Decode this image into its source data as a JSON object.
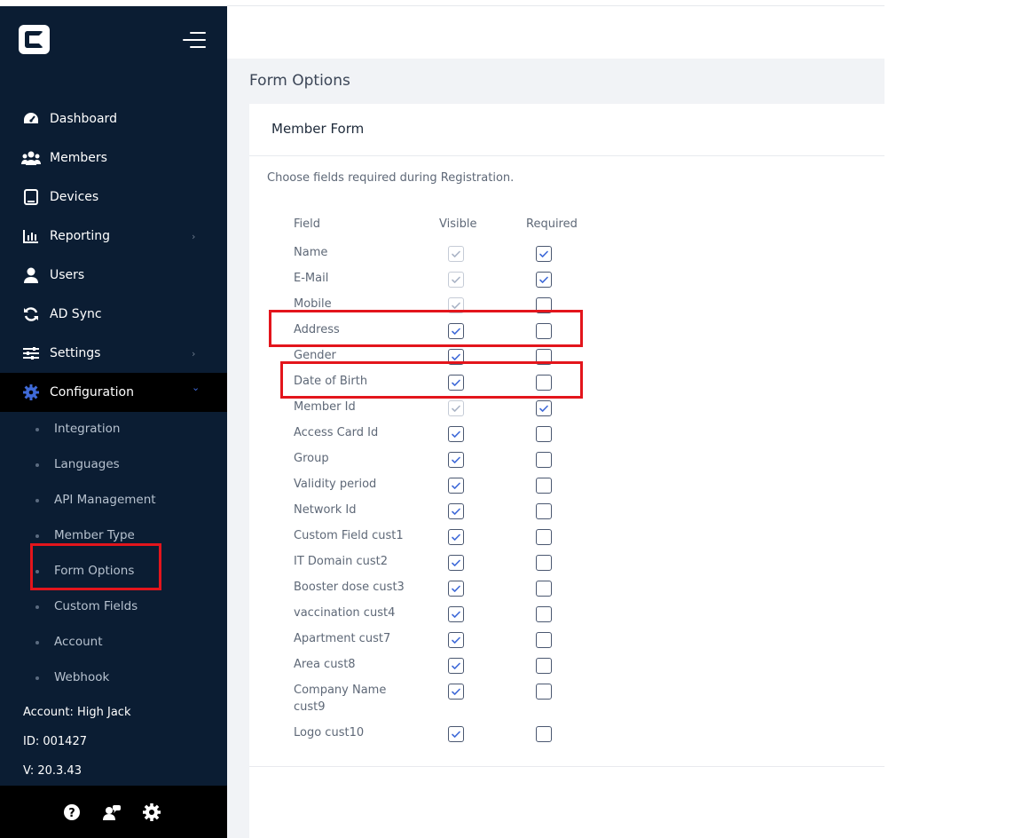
{
  "sidebar": {
    "nav": [
      {
        "label": "Dashboard",
        "icon": "dashboard-icon"
      },
      {
        "label": "Members",
        "icon": "members-icon"
      },
      {
        "label": "Devices",
        "icon": "tablet-icon"
      },
      {
        "label": "Reporting",
        "icon": "bar-chart-icon"
      },
      {
        "label": "Users",
        "icon": "user-icon"
      },
      {
        "label": "AD Sync",
        "icon": "sync-icon"
      },
      {
        "label": "Settings",
        "icon": "sliders-icon"
      },
      {
        "label": "Configuration",
        "icon": "gear-icon"
      }
    ],
    "chevron_right": "›",
    "chevron_down": "⌄",
    "sub": [
      {
        "label": "Integration"
      },
      {
        "label": "Languages"
      },
      {
        "label": "API Management"
      },
      {
        "label": "Member Type"
      },
      {
        "label": "Form Options"
      },
      {
        "label": "Custom Fields"
      },
      {
        "label": "Account"
      },
      {
        "label": "Webhook"
      }
    ],
    "account": "Account: High Jack",
    "id": "ID: 001427",
    "version": "V: 20.3.43",
    "footer_icons": [
      "help-icon",
      "user-chat-icon",
      "settings-gear-icon"
    ]
  },
  "page": {
    "title": "Form Options",
    "card_title": "Member Form",
    "description": "Choose fields required during Registration.",
    "columns": {
      "field": "Field",
      "visible": "Visible",
      "required": "Required"
    },
    "rows": [
      {
        "label": "Name",
        "visible": true,
        "visible_disabled": true,
        "required": true
      },
      {
        "label": "E-Mail",
        "visible": true,
        "visible_disabled": true,
        "required": true
      },
      {
        "label": "Mobile",
        "visible": true,
        "visible_disabled": true,
        "required": false
      },
      {
        "label": "Address",
        "visible": true,
        "visible_disabled": false,
        "required": false
      },
      {
        "label": "Gender",
        "visible": true,
        "visible_disabled": false,
        "required": false
      },
      {
        "label": "Date of Birth",
        "visible": true,
        "visible_disabled": false,
        "required": false
      },
      {
        "label": "Member Id",
        "visible": true,
        "visible_disabled": true,
        "required": true
      },
      {
        "label": "Access Card Id",
        "visible": true,
        "visible_disabled": false,
        "required": false
      },
      {
        "label": "Group",
        "visible": true,
        "visible_disabled": false,
        "required": false
      },
      {
        "label": "Validity period",
        "visible": true,
        "visible_disabled": false,
        "required": false
      },
      {
        "label": "Network Id",
        "visible": true,
        "visible_disabled": false,
        "required": false
      },
      {
        "label": "Custom Field cust1",
        "visible": true,
        "visible_disabled": false,
        "required": false
      },
      {
        "label": "IT Domain cust2",
        "visible": true,
        "visible_disabled": false,
        "required": false
      },
      {
        "label": "Booster dose cust3",
        "visible": true,
        "visible_disabled": false,
        "required": false
      },
      {
        "label": "vaccination cust4",
        "visible": true,
        "visible_disabled": false,
        "required": false
      },
      {
        "label": "Apartment cust7",
        "visible": true,
        "visible_disabled": false,
        "required": false
      },
      {
        "label": "Area cust8",
        "visible": true,
        "visible_disabled": false,
        "required": false
      },
      {
        "label": "Company Name cust9",
        "visible": true,
        "visible_disabled": false,
        "required": false
      },
      {
        "label": "Logo cust10",
        "visible": true,
        "visible_disabled": false,
        "required": false
      }
    ]
  },
  "colors": {
    "sidebar_bg": "#0b1d33",
    "active_bg": "#000000",
    "accent": "#3f6ad8",
    "highlight": "#e3151c"
  }
}
